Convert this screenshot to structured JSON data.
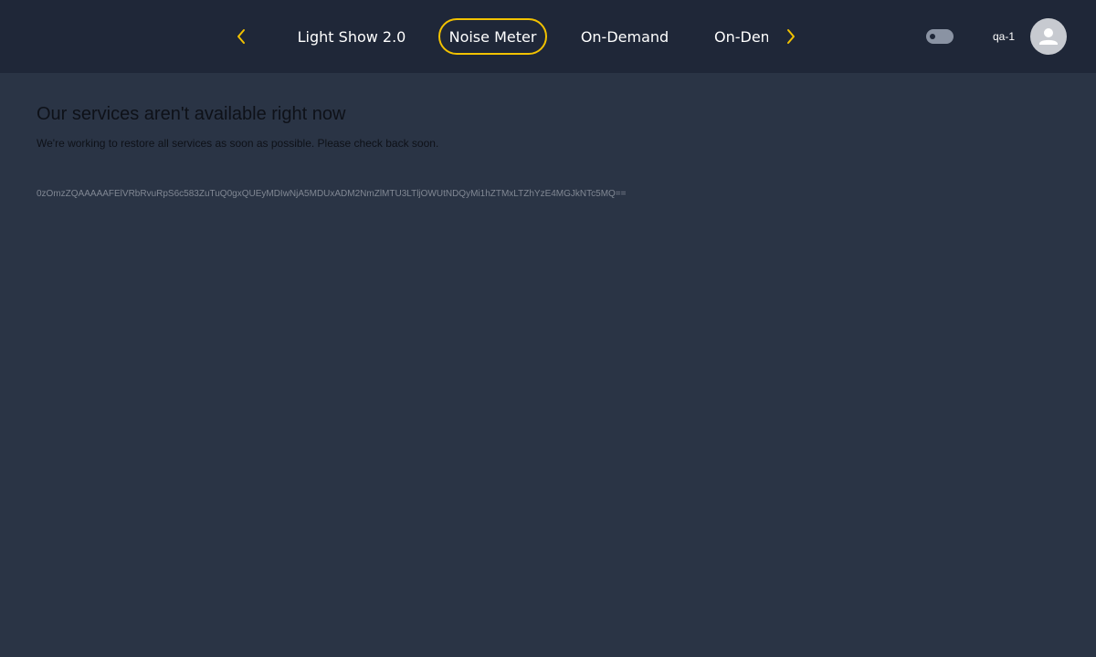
{
  "nav": {
    "prev_icon": "chevron-left-icon",
    "next_icon": "chevron-right-icon",
    "accent_color": "#f2c200",
    "tabs": [
      {
        "label": "Light Show 2.0",
        "active": false
      },
      {
        "label": "Noise Meter",
        "active": true
      },
      {
        "label": "On-Demand",
        "active": false
      },
      {
        "label": "On-Demand",
        "active": false
      }
    ]
  },
  "header": {
    "toggle": {
      "on": false
    },
    "username": "qa-1",
    "avatar_icon": "user-avatar-icon"
  },
  "error": {
    "title": "Our services aren't available right now",
    "message": "We're working to restore all services as soon as possible. Please check back soon.",
    "code": "0zOmzZQAAAAAFElVRbRvuRpS6c583ZuTuQ0gxQUEyMDIwNjA5MDUxADM2NmZlMTU3LTljOWUtNDQyMi1hZTMxLTZhYzE4MGJkNTc5MQ=="
  },
  "colors": {
    "page_background": "#2a3445",
    "topbar_background": "#1f2738"
  }
}
